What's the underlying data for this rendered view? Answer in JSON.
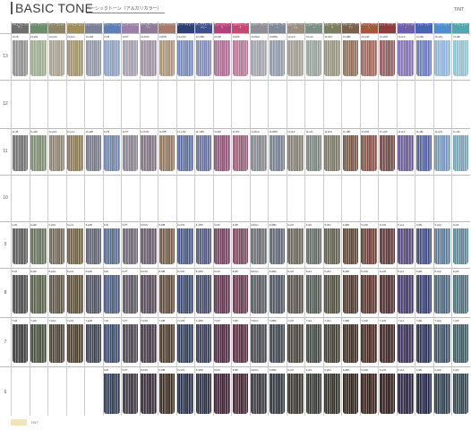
{
  "header": {
    "title": "BASIC TONE",
    "subtitle": "ベーシックトーン（アルカリカラー）",
    "right_label": "TINT"
  },
  "legend": {
    "label": "TINT"
  },
  "levels": [
    "13",
    "12",
    "11",
    "10",
    "9",
    "8",
    "7",
    "6"
  ],
  "columns": [
    {
      "header": "ナチュラル ブラウン",
      "color": "#6e6e6e",
      "codes": {
        "13": "13-nB",
        "11": "11-nB",
        "9": "9-nB",
        "8": "8-nB",
        "7": "7-nB"
      },
      "swatch": {
        "13": "#8d8d8d",
        "11": "#6f6f6f",
        "9": "#5a5a5a",
        "8": "#4b4b4b",
        "7": "#3c3c3c"
      }
    },
    {
      "header": "マット グリーン",
      "color": "#6c8d6c",
      "codes": {
        "13": "13-aMt",
        "11": "11-aMt",
        "9": "9-aMt",
        "8": "8-aMt",
        "7": "7-aMt"
      },
      "swatch": {
        "13": "#9aaa8c",
        "11": "#7d8a6f",
        "9": "#65705b",
        "8": "#566049",
        "7": "#454d3d"
      }
    },
    {
      "header": "マット ゴールド",
      "color": "#8c8464",
      "codes": {
        "13": "13-pGG",
        "11": "11-pGG",
        "9": "9-pGG",
        "8": "8-pGG",
        "7": "7-pGG"
      },
      "swatch": {
        "13": "#a59e8c",
        "11": "#8a8170",
        "9": "#6f6655",
        "8": "#5b5343",
        "7": "#4a4235"
      }
    },
    {
      "header": "パール ゴールド",
      "color": "#a08e5a",
      "codes": {
        "13": "13-pLG",
        "11": "11-pLG",
        "9": "9-pLG",
        "8": "8-pLG",
        "7": "7-pLG"
      },
      "swatch": {
        "13": "#9d8f6a",
        "11": "#887757",
        "9": "#6e5f42",
        "8": "#5b4d35",
        "7": "#4a3d2a"
      }
    },
    {
      "header": "セピア ブラウン",
      "color": "#7a7f9a",
      "codes": {
        "13": "13-aAB",
        "11": "11-aAB",
        "9": "9-aAB",
        "8": "8-aAB",
        "7": "7-aAB"
      },
      "swatch": {
        "13": "#8f94a3",
        "11": "#747886",
        "9": "#5d6170",
        "8": "#4d5060",
        "7": "#3d4050"
      }
    },
    {
      "header": "ブルー アッシュ",
      "color": "#5d7fb5",
      "codes": {
        "13": "13-iB",
        "11": "11-iB",
        "9": "9-iB",
        "8": "8-iB",
        "7": "7-iB",
        "6": "6-iB"
      },
      "swatch": {
        "13": "#8a9ec4",
        "11": "#6f82aa",
        "9": "#56688e",
        "8": "#495a7d",
        "7": "#3b4a69",
        "6": "#2f3b55"
      }
    },
    {
      "header": "ピンク アッシュ",
      "color": "#9a7fa8",
      "codes": {
        "13": "13-PT",
        "11": "11-PT",
        "9": "9-PT",
        "8": "8-PT",
        "7": "7-PT",
        "6": "6-PT"
      },
      "swatch": {
        "13": "#a39bab",
        "11": "#87808e",
        "9": "#6c6573",
        "8": "#5b5461",
        "7": "#4a444f",
        "6": "#3a3540"
      }
    },
    {
      "header": "ラベンダー ブラウン",
      "color": "#8d7a98",
      "codes": {
        "13": "13-KON",
        "11": "11-KON",
        "9": "9-KON",
        "8": "8-KON",
        "7": "7-KON",
        "6": "6-KON"
      },
      "swatch": {
        "13": "#9c8f9f",
        "11": "#7f7283",
        "9": "#655a6a",
        "8": "#544957",
        "7": "#433946",
        "6": "#352c37"
      }
    },
    {
      "header": "ローズ ブラウン",
      "color": "#a87a6a",
      "codes": {
        "13": "13-RIB",
        "11": "11-RIB",
        "9": "9-RIB",
        "8": "8-RIB",
        "7": "7-RIB",
        "6": "6-RIB"
      },
      "swatch": {
        "13": "#a79178",
        "11": "#8b7560",
        "9": "#705b48",
        "8": "#5e4a3a",
        "7": "#4c3a2d",
        "6": "#3b2c22"
      }
    },
    {
      "header": "モード ネイビー",
      "color": "#2e3f73",
      "codes": {
        "13": "13-mNV",
        "11": "11-mNV",
        "9": "9-mNV",
        "8": "8-mNV",
        "7": "7-mNV",
        "6": "6-mNV"
      },
      "swatch": {
        "13": "#7486b8",
        "11": "#5c6c9c",
        "9": "#465582",
        "8": "#3a476d",
        "7": "#2f3a59",
        "6": "#252e47"
      }
    },
    {
      "header": "ダークブルー ネイビー",
      "color": "#3e4f8a",
      "codes": {
        "13": "13-mBN",
        "11": "11-mBN",
        "9": "9-mBN",
        "8": "8-mBN",
        "7": "7-mBN",
        "6": "6-mBN"
      },
      "swatch": {
        "13": "#8089b6",
        "11": "#676f98",
        "9": "#51587c",
        "8": "#434967",
        "7": "#363a54",
        "6": "#2a2e42"
      }
    },
    {
      "header": "フューシャ ピンク",
      "color": "#b0437e",
      "codes": {
        "13": "13-fAP",
        "11": "11-fAP",
        "9": "9-fAP",
        "8": "8-fAP",
        "7": "7-fAP",
        "6": "6-fAP"
      },
      "swatch": {
        "13": "#a86a92",
        "11": "#8c5377",
        "9": "#72405f",
        "8": "#5f344f",
        "7": "#4d2940",
        "6": "#3c2032"
      }
    },
    {
      "header": "ラズベリー ピンク",
      "color": "#c04a72",
      "codes": {
        "13": "13-fPK",
        "11": "11-fPK",
        "9": "9-fPK",
        "8": "8-fPK",
        "7": "7-fPK",
        "6": "6-fPK"
      },
      "swatch": {
        "13": "#b57590",
        "11": "#975b74",
        "9": "#7b465c",
        "8": "#67384c",
        "7": "#542c3d",
        "6": "#41222f"
      }
    },
    {
      "header": "シルバー グレー",
      "color": "#8e8e94",
      "codes": {
        "13": "13-RGG",
        "11": "11-RGG",
        "9": "9-RGG",
        "8": "8-RGG",
        "7": "7-RGG",
        "6": "6-RGG"
      },
      "swatch": {
        "13": "#a0a0a8",
        "11": "#84848c",
        "9": "#6a6a72",
        "8": "#585860",
        "7": "#47474e",
        "6": "#37373d"
      }
    },
    {
      "header": "スモーキー グレー",
      "color": "#7f8a99",
      "codes": {
        "13": "13-RBG",
        "11": "11-RBG",
        "9": "9-RBG",
        "8": "8-RBG",
        "7": "7-RBG",
        "6": "6-RBG"
      },
      "swatch": {
        "13": "#8e98a8",
        "11": "#747e8d",
        "9": "#5d6673",
        "8": "#4d5560",
        "7": "#3e454f",
        "6": "#30363e"
      }
    },
    {
      "header": "スモーキー ベージュ",
      "color": "#9a8e80",
      "codes": {
        "13": "13-oLP",
        "11": "11-oLP",
        "9": "9-oLP",
        "8": "8-oLP",
        "7": "7-oLP",
        "6": "6-oLP"
      },
      "swatch": {
        "13": "#9f9a8f",
        "11": "#837e73",
        "9": "#69645a",
        "8": "#58534a",
        "7": "#47433b",
        "6": "#38342e"
      }
    },
    {
      "header": "ミスティ グリーン",
      "color": "#7b8f87",
      "codes": {
        "13": "13-oIG",
        "11": "11-oIG",
        "9": "9-oIG",
        "8": "8-oIG",
        "7": "7-oIG",
        "6": "6-oIG"
      },
      "swatch": {
        "13": "#96a09a",
        "11": "#7a847e",
        "9": "#616a65",
        "8": "#515954",
        "7": "#414844",
        "6": "#333935"
      }
    },
    {
      "header": "スモーキー カーキ",
      "color": "#7d7e60",
      "codes": {
        "13": "13-sKH",
        "11": "11-sKH",
        "9": "9-sKH",
        "8": "8-sKH",
        "7": "7-sKH",
        "6": "6-sKH"
      },
      "swatch": {
        "13": "#95937c",
        "11": "#797763",
        "9": "#605e4d",
        "8": "#504e3f",
        "7": "#403e32",
        "6": "#323027"
      }
    },
    {
      "header": "スモーキー ブラウン",
      "color": "#7b5f4d",
      "codes": {
        "13": "13-sBR",
        "11": "11-sBR",
        "9": "9-sBR",
        "8": "8-sBR",
        "7": "7-sBR",
        "6": "6-sBR"
      },
      "swatch": {
        "13": "#8c6b58",
        "11": "#735544",
        "9": "#5d4335",
        "8": "#4d372b",
        "7": "#3e2c22",
        "6": "#30221a"
      }
    },
    {
      "header": "オレンジ ブラウン",
      "color": "#a3583e",
      "codes": {
        "13": "13-sOR",
        "11": "11-sOR",
        "9": "9-sOR",
        "8": "8-sOR",
        "7": "7-sOR",
        "6": "6-sOR"
      },
      "swatch": {
        "13": "#9b6456",
        "11": "#804f43",
        "9": "#683e34",
        "8": "#56322a",
        "7": "#452720",
        "6": "#351e18"
      }
    },
    {
      "header": "レッド ブラウン",
      "color": "#8e3b3b",
      "codes": {
        "13": "13-sOR",
        "11": "11-sCR",
        "9": "9-sCR",
        "8": "8-sCR",
        "7": "7-sCR",
        "6": "6-sCR"
      },
      "swatch": {
        "13": "#8a5a5a",
        "11": "#714545",
        "9": "#5b3636",
        "8": "#4b2c2c",
        "7": "#3c2323",
        "6": "#2e1b1b"
      }
    },
    {
      "header": "ソフト ラベンダー",
      "color": "#6e5fa8",
      "codes": {
        "13": "13-sLA",
        "11": "11-sLA",
        "9": "9-sLA",
        "8": "8-sLA",
        "7": "7-sLA",
        "6": "6-sLA"
      },
      "swatch": {
        "13": "#7f70b2",
        "11": "#675996",
        "9": "#51457a",
        "8": "#433965",
        "7": "#362d52",
        "6": "#2a2340"
      }
    },
    {
      "header": "ソフト ブルー",
      "color": "#4a63ad",
      "codes": {
        "13": "13-sBL",
        "11": "11-sBL",
        "9": "9-sBL",
        "8": "8-sBL",
        "7": "7-sBL",
        "6": "6-sBL"
      },
      "swatch": {
        "13": "#6979b8",
        "11": "#53619b",
        "9": "#404c7f",
        "8": "#343e69",
        "7": "#293155",
        "6": "#202643"
      }
    },
    {
      "header": "ソフト アクア",
      "color": "#4e8fc8",
      "codes": {
        "13": "13-sAQ",
        "11": "11-sAQ",
        "9": "9-sAQ",
        "8": "8-sAQ",
        "7": "7-sAQ",
        "6": "6-sAQ"
      },
      "swatch": {
        "13": "#8fb3d8",
        "11": "#7596b8",
        "9": "#5d7a97",
        "8": "#4d657d",
        "7": "#3e5166",
        "6": "#303f4f"
      }
    },
    {
      "header": "ソフト ミント",
      "color": "#52a6b0",
      "codes": {
        "13": "13-sMi",
        "11": "11-sMi",
        "9": "9-sMi",
        "8": "8-sMi",
        "7": "7-sMi",
        "6": "6-sMi"
      },
      "swatch": {
        "13": "#8fc0d0",
        "11": "#76a2b0",
        "9": "#5e8492",
        "8": "#4e6e7a",
        "7": "#3f5963",
        "6": "#31454d"
      }
    }
  ]
}
